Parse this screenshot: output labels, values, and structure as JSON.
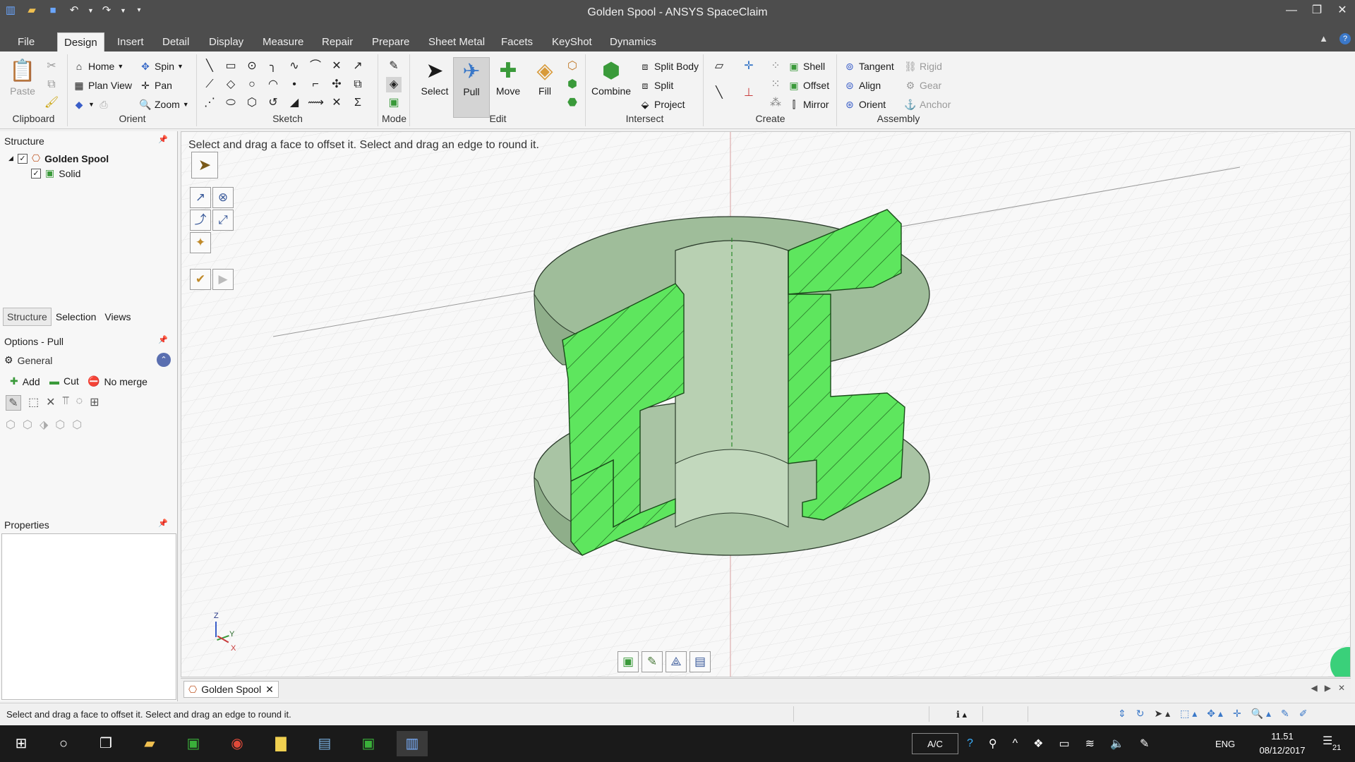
{
  "window": {
    "title": "Golden Spool - ANSYS SpaceClaim"
  },
  "tabs": [
    "File",
    "Design",
    "Insert",
    "Detail",
    "Display",
    "Measure",
    "Repair",
    "Prepare",
    "Sheet Metal",
    "Facets",
    "KeyShot",
    "Dynamics"
  ],
  "ribbon": {
    "clipboard": {
      "label": "Clipboard",
      "paste": "Paste"
    },
    "orient": {
      "label": "Orient",
      "home": "Home",
      "spin": "Spin",
      "plan_view": "Plan View",
      "pan": "Pan",
      "zoom": "Zoom"
    },
    "sketch": {
      "label": "Sketch"
    },
    "mode": {
      "label": "Mode"
    },
    "edit": {
      "label": "Edit",
      "select": "Select",
      "pull": "Pull",
      "move": "Move",
      "fill": "Fill"
    },
    "intersect": {
      "label": "Intersect",
      "combine": "Combine",
      "split_body": "Split Body",
      "split": "Split",
      "project": "Project"
    },
    "create": {
      "label": "Create",
      "shell": "Shell",
      "offset": "Offset",
      "mirror": "Mirror"
    },
    "assembly": {
      "label": "Assembly",
      "tangent": "Tangent",
      "align": "Align",
      "orient": "Orient",
      "rigid": "Rigid",
      "gear": "Gear",
      "anchor": "Anchor"
    }
  },
  "structure": {
    "header": "Structure",
    "root": "Golden Spool",
    "child": "Solid",
    "tabs": [
      "Structure",
      "Selection",
      "Views"
    ]
  },
  "options": {
    "header": "Options - Pull",
    "general": "General",
    "add": "Add",
    "cut": "Cut",
    "no_merge": "No merge"
  },
  "properties": {
    "header": "Properties"
  },
  "viewport": {
    "hint": "Select and drag a face to offset it. Select and drag an edge to round it.",
    "axis_z": "Z",
    "axis_y": "Y",
    "axis_x": "X"
  },
  "doc_tab": {
    "label": "Golden Spool"
  },
  "status": {
    "text": "Select and drag a face to offset it. Select and drag an edge to round it."
  },
  "taskbar": {
    "ac": "A/C",
    "lang": "ENG",
    "time": "11.51",
    "date": "08/12/2017",
    "notif": "21"
  },
  "colors": {
    "section_fill": "#5ee65e",
    "body": "#a9c4a4",
    "chrome": "#4d4d4d"
  }
}
